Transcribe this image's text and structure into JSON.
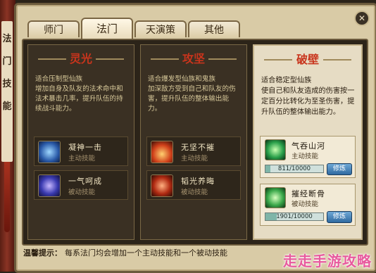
{
  "window": {
    "close_label": "✕"
  },
  "side_scroll": {
    "glyphs": [
      "法",
      "门",
      "技",
      "能"
    ]
  },
  "tabs": [
    {
      "label": "师门"
    },
    {
      "label": "法门"
    },
    {
      "label": "天演策"
    },
    {
      "label": "其他"
    }
  ],
  "panels": [
    {
      "title": "灵光",
      "desc": "适合压制型仙族\n增加自身及队友的法术命中和法术暴击几率，提升队伍的持续战斗能力。",
      "skills": [
        {
          "name": "凝神一击",
          "type": "主动技能",
          "icon": "spirit-strike-icon"
        },
        {
          "name": "一气呵成",
          "type": "被动技能",
          "icon": "one-breath-icon"
        }
      ]
    },
    {
      "title": "攻坚",
      "desc": "适合爆发型仙族和鬼族\n加深敌方受到自己和队友的伤害，提升队伍的整体输出能力。",
      "skills": [
        {
          "name": "无坚不摧",
          "type": "主动技能",
          "icon": "unstoppable-icon"
        },
        {
          "name": "韬光养晦",
          "type": "被动技能",
          "icon": "hidden-light-icon"
        }
      ]
    },
    {
      "title": "破壁",
      "desc": "适合稳定型仙族\n使自己和队友造成的伤害按一定百分比转化为至圣伤害，提升队伍的整体输出能力。",
      "skills": [
        {
          "name": "气吞山河",
          "type": "主动技能",
          "icon": "swallow-mountains-icon",
          "progress_text": "811/10000",
          "progress": 0.0811,
          "button": "修炼"
        },
        {
          "name": "摧经断骨",
          "type": "被动技能",
          "icon": "break-bones-icon",
          "progress_text": "1901/10000",
          "progress": 0.1901,
          "button": "修炼"
        }
      ]
    }
  ],
  "tip": {
    "label": "温馨提示：",
    "text": "每系法门均会增加一个主动技能和一个被动技能"
  },
  "watermark": "走走手游攻略",
  "colors": {
    "title_red": "#c8341c",
    "frame": "#d9cba6",
    "panel_dark": "#3a3023"
  }
}
